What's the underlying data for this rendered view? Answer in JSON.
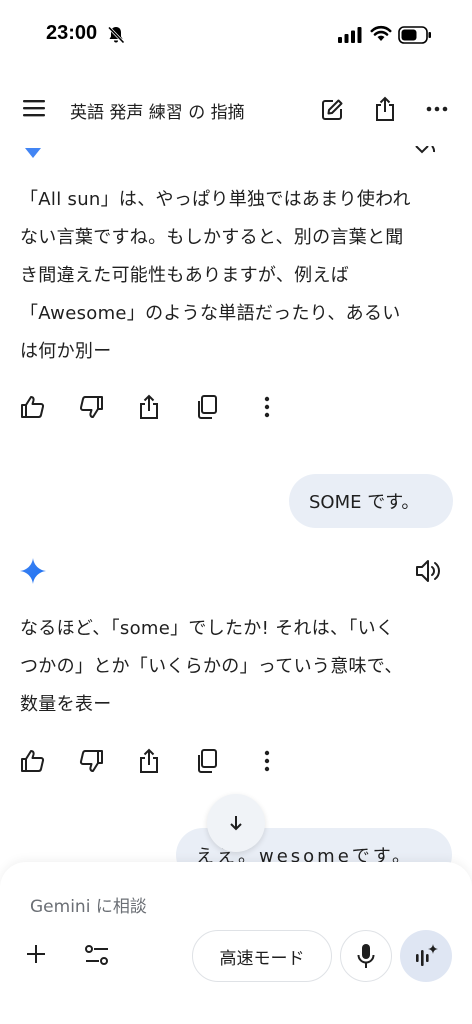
{
  "status_bar": {
    "time": "23:00"
  },
  "header": {
    "title": "英語 発声 練習 の 指摘"
  },
  "messages": {
    "bot_1": {
      "lines": [
        "「All sun」は、やっぱり単独ではあまり使われ",
        "ない言葉ですね。もしかすると、別の言葉と聞",
        "き間違えた可能性もありますが、例えば",
        "「Awesome」のような単語だったり、あるい",
        "は何か別ー"
      ]
    },
    "user_1": "SOME です。",
    "bot_2": {
      "lines": [
        "なるほど、「some」でしたか! それは、「いく",
        "つかの」とか「いくらかの」っていう意味で、",
        "数量を表ー"
      ]
    },
    "user_2": "ええ。wesomeです。"
  },
  "input": {
    "placeholder": "Gemini に相談",
    "mode_label": "高速モード"
  },
  "colors": {
    "accent": "#4285f4",
    "bubble": "#e9eef6",
    "live_button": "#dfe6f3"
  },
  "icons": [
    "bell-off-icon",
    "signal-icon",
    "wifi-icon",
    "battery-icon",
    "menu-icon",
    "edit-icon",
    "share-icon",
    "more-icon",
    "gemini-star-icon",
    "speaker-icon",
    "thumbs-up-icon",
    "thumbs-down-icon",
    "copy-icon",
    "arrow-down-icon",
    "plus-icon",
    "tools-icon",
    "mic-icon",
    "live-icon"
  ]
}
